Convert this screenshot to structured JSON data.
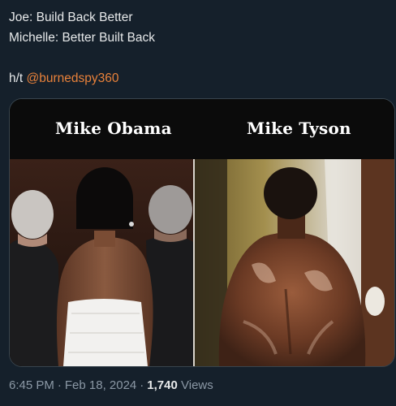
{
  "tweet": {
    "line1": "Joe: Build Back Better",
    "line2": "Michelle: Better Built Back",
    "ht_prefix": "h/t ",
    "mention": "@burnedspy360"
  },
  "media": {
    "left_caption": "Mike Obama",
    "right_caption": "Mike Tyson"
  },
  "meta": {
    "time": "6:45 PM",
    "date": "Feb 18, 2024",
    "views_count": "1,740",
    "views_label": "Views"
  },
  "colors": {
    "background": "#15202b",
    "text": "#e7e9ea",
    "mention": "#e8813a",
    "muted": "#8b98a5"
  }
}
